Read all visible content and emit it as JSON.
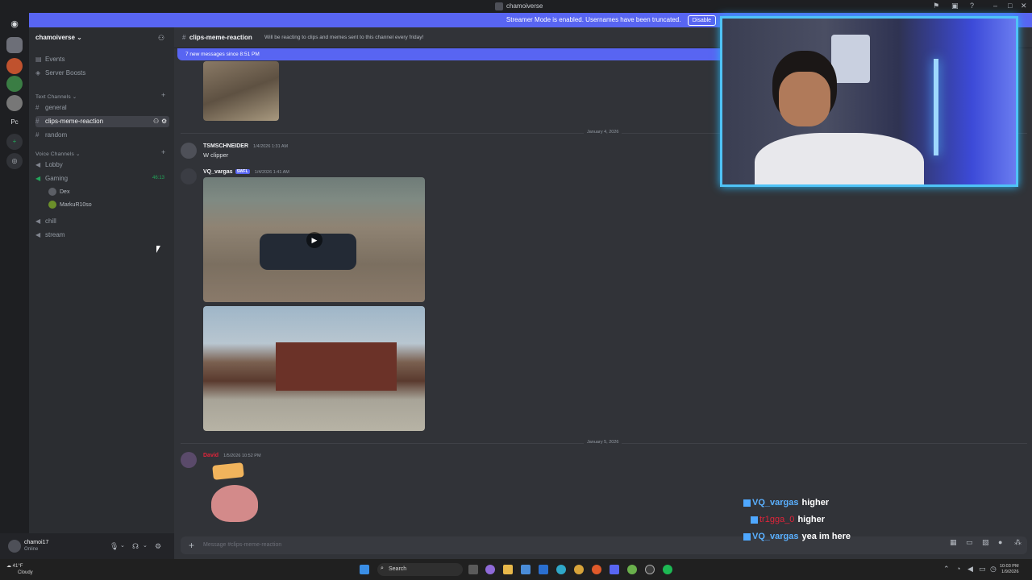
{
  "window": {
    "title": "chamoiverse"
  },
  "banner": {
    "text": "Streamer Mode is enabled. Usernames have been truncated.",
    "disable_label": "Disable"
  },
  "server": {
    "name": "chamoiverse",
    "top_items": [
      {
        "label": "Events"
      },
      {
        "label": "Server Boosts"
      }
    ],
    "text_category": "Text Channels",
    "text_channels": [
      {
        "label": "general"
      },
      {
        "label": "clips-meme-reaction"
      },
      {
        "label": "random"
      }
    ],
    "voice_category": "Voice Channels",
    "voice_channels": [
      {
        "label": "Lobby"
      },
      {
        "label": "Gaming"
      },
      {
        "label": "chill"
      },
      {
        "label": "stream"
      }
    ],
    "gaming_count": "46:13",
    "voice_users": [
      {
        "label": "Dex"
      },
      {
        "label": "MarkuR10so"
      }
    ]
  },
  "user": {
    "name": "chamoi17",
    "status": "Online"
  },
  "channel": {
    "name": "clips-meme-reaction",
    "topic": "Will be reacting to clips and memes sent to this channel every friday!",
    "new_messages": "7 new messages since 8:51 PM"
  },
  "messages": [
    {
      "author": "TSMSCHNEIDER",
      "time": "1/4/2026 1:31 AM",
      "text": "W clipper"
    },
    {
      "author": "VQ_vargas",
      "tag": "SWFL",
      "time": "1/4/2026 1:41 AM"
    },
    {
      "author": "David",
      "time": "1/5/2026 10:52 PM"
    }
  ],
  "dividers": [
    "January 4, 2026",
    "January 5, 2026"
  ],
  "composer": {
    "placeholder": "Message #clips-meme-reaction"
  },
  "overlay_chat": [
    {
      "user": "VQ_vargas",
      "text": "higher"
    },
    {
      "user": "tr1gga_0",
      "text": "higher"
    },
    {
      "user": "VQ_vargas",
      "text": "yea im here"
    }
  ],
  "taskbar": {
    "search_label": "Search",
    "weather_temp": "41°F",
    "weather_desc": "Cloudy",
    "time": "10:03 PM",
    "date": "1/9/2026"
  },
  "colors": {
    "blurple": "#5865f2",
    "online": "#23a55a",
    "cam_glow": "#4fc3f7"
  }
}
